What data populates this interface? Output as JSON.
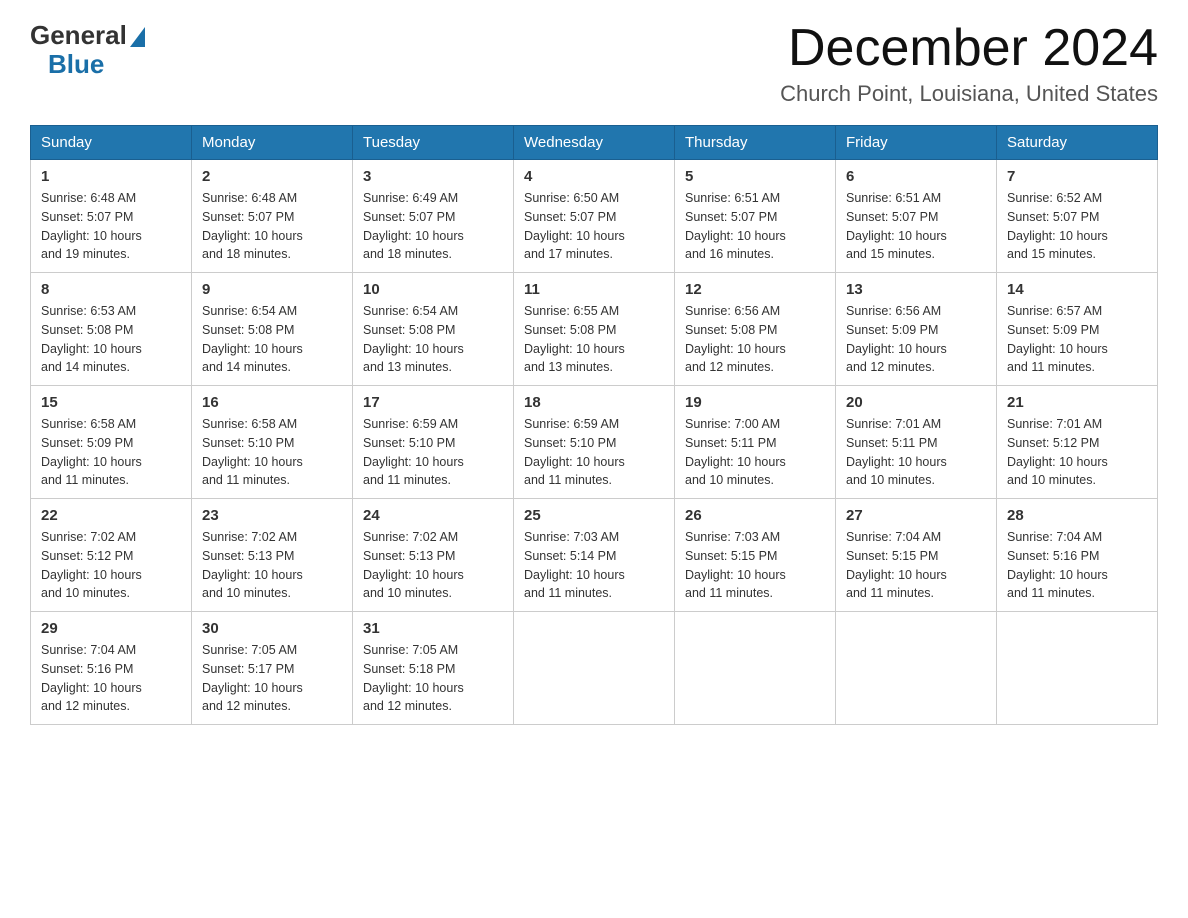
{
  "header": {
    "logo_general": "General",
    "logo_blue": "Blue",
    "month_title": "December 2024",
    "location": "Church Point, Louisiana, United States"
  },
  "days_of_week": [
    "Sunday",
    "Monday",
    "Tuesday",
    "Wednesday",
    "Thursday",
    "Friday",
    "Saturday"
  ],
  "weeks": [
    [
      {
        "day": "1",
        "sunrise": "6:48 AM",
        "sunset": "5:07 PM",
        "daylight": "10 hours and 19 minutes."
      },
      {
        "day": "2",
        "sunrise": "6:48 AM",
        "sunset": "5:07 PM",
        "daylight": "10 hours and 18 minutes."
      },
      {
        "day": "3",
        "sunrise": "6:49 AM",
        "sunset": "5:07 PM",
        "daylight": "10 hours and 18 minutes."
      },
      {
        "day": "4",
        "sunrise": "6:50 AM",
        "sunset": "5:07 PM",
        "daylight": "10 hours and 17 minutes."
      },
      {
        "day": "5",
        "sunrise": "6:51 AM",
        "sunset": "5:07 PM",
        "daylight": "10 hours and 16 minutes."
      },
      {
        "day": "6",
        "sunrise": "6:51 AM",
        "sunset": "5:07 PM",
        "daylight": "10 hours and 15 minutes."
      },
      {
        "day": "7",
        "sunrise": "6:52 AM",
        "sunset": "5:07 PM",
        "daylight": "10 hours and 15 minutes."
      }
    ],
    [
      {
        "day": "8",
        "sunrise": "6:53 AM",
        "sunset": "5:08 PM",
        "daylight": "10 hours and 14 minutes."
      },
      {
        "day": "9",
        "sunrise": "6:54 AM",
        "sunset": "5:08 PM",
        "daylight": "10 hours and 14 minutes."
      },
      {
        "day": "10",
        "sunrise": "6:54 AM",
        "sunset": "5:08 PM",
        "daylight": "10 hours and 13 minutes."
      },
      {
        "day": "11",
        "sunrise": "6:55 AM",
        "sunset": "5:08 PM",
        "daylight": "10 hours and 13 minutes."
      },
      {
        "day": "12",
        "sunrise": "6:56 AM",
        "sunset": "5:08 PM",
        "daylight": "10 hours and 12 minutes."
      },
      {
        "day": "13",
        "sunrise": "6:56 AM",
        "sunset": "5:09 PM",
        "daylight": "10 hours and 12 minutes."
      },
      {
        "day": "14",
        "sunrise": "6:57 AM",
        "sunset": "5:09 PM",
        "daylight": "10 hours and 11 minutes."
      }
    ],
    [
      {
        "day": "15",
        "sunrise": "6:58 AM",
        "sunset": "5:09 PM",
        "daylight": "10 hours and 11 minutes."
      },
      {
        "day": "16",
        "sunrise": "6:58 AM",
        "sunset": "5:10 PM",
        "daylight": "10 hours and 11 minutes."
      },
      {
        "day": "17",
        "sunrise": "6:59 AM",
        "sunset": "5:10 PM",
        "daylight": "10 hours and 11 minutes."
      },
      {
        "day": "18",
        "sunrise": "6:59 AM",
        "sunset": "5:10 PM",
        "daylight": "10 hours and 11 minutes."
      },
      {
        "day": "19",
        "sunrise": "7:00 AM",
        "sunset": "5:11 PM",
        "daylight": "10 hours and 10 minutes."
      },
      {
        "day": "20",
        "sunrise": "7:01 AM",
        "sunset": "5:11 PM",
        "daylight": "10 hours and 10 minutes."
      },
      {
        "day": "21",
        "sunrise": "7:01 AM",
        "sunset": "5:12 PM",
        "daylight": "10 hours and 10 minutes."
      }
    ],
    [
      {
        "day": "22",
        "sunrise": "7:02 AM",
        "sunset": "5:12 PM",
        "daylight": "10 hours and 10 minutes."
      },
      {
        "day": "23",
        "sunrise": "7:02 AM",
        "sunset": "5:13 PM",
        "daylight": "10 hours and 10 minutes."
      },
      {
        "day": "24",
        "sunrise": "7:02 AM",
        "sunset": "5:13 PM",
        "daylight": "10 hours and 10 minutes."
      },
      {
        "day": "25",
        "sunrise": "7:03 AM",
        "sunset": "5:14 PM",
        "daylight": "10 hours and 11 minutes."
      },
      {
        "day": "26",
        "sunrise": "7:03 AM",
        "sunset": "5:15 PM",
        "daylight": "10 hours and 11 minutes."
      },
      {
        "day": "27",
        "sunrise": "7:04 AM",
        "sunset": "5:15 PM",
        "daylight": "10 hours and 11 minutes."
      },
      {
        "day": "28",
        "sunrise": "7:04 AM",
        "sunset": "5:16 PM",
        "daylight": "10 hours and 11 minutes."
      }
    ],
    [
      {
        "day": "29",
        "sunrise": "7:04 AM",
        "sunset": "5:16 PM",
        "daylight": "10 hours and 12 minutes."
      },
      {
        "day": "30",
        "sunrise": "7:05 AM",
        "sunset": "5:17 PM",
        "daylight": "10 hours and 12 minutes."
      },
      {
        "day": "31",
        "sunrise": "7:05 AM",
        "sunset": "5:18 PM",
        "daylight": "10 hours and 12 minutes."
      },
      null,
      null,
      null,
      null
    ]
  ],
  "labels": {
    "sunrise": "Sunrise:",
    "sunset": "Sunset:",
    "daylight": "Daylight:"
  }
}
